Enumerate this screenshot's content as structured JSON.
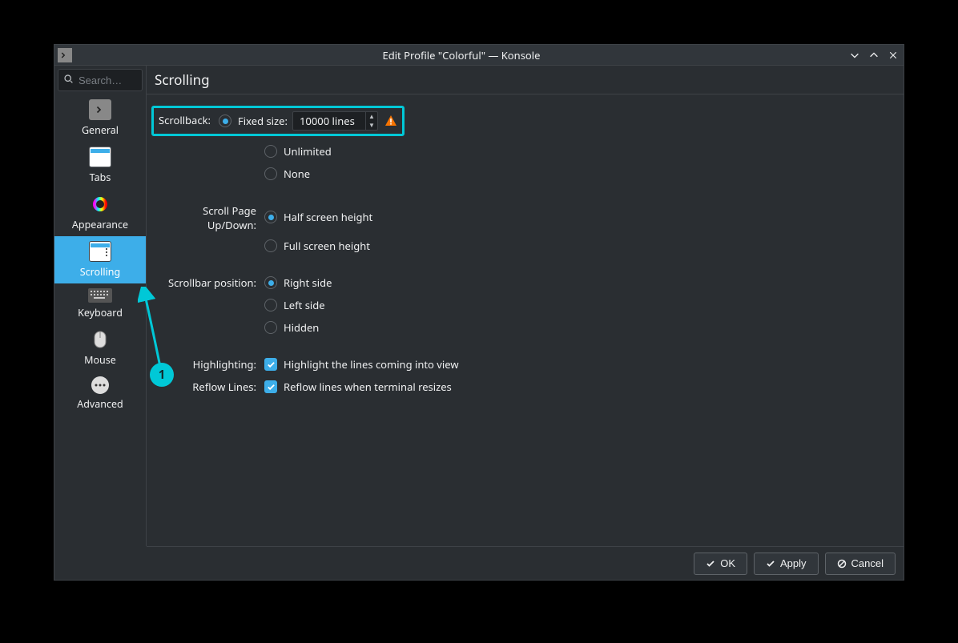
{
  "window": {
    "title": "Edit Profile \"Colorful\" — Konsole"
  },
  "sidebar": {
    "search_placeholder": "Search…",
    "items": [
      {
        "label": "General"
      },
      {
        "label": "Tabs"
      },
      {
        "label": "Appearance"
      },
      {
        "label": "Scrolling"
      },
      {
        "label": "Keyboard"
      },
      {
        "label": "Mouse"
      },
      {
        "label": "Advanced"
      }
    ],
    "selected_index": 3
  },
  "page": {
    "title": "Scrolling",
    "scrollback": {
      "label": "Scrollback:",
      "options": {
        "fixed": "Fixed size:",
        "unlimited": "Unlimited",
        "none": "None"
      },
      "selected": "fixed",
      "fixed_value": "10000 lines"
    },
    "scroll_page": {
      "label": "Scroll Page Up/Down:",
      "options": {
        "half": "Half screen height",
        "full": "Full screen height"
      },
      "selected": "half"
    },
    "scrollbar_pos": {
      "label": "Scrollbar position:",
      "options": {
        "right": "Right side",
        "left": "Left side",
        "hidden": "Hidden"
      },
      "selected": "right"
    },
    "highlighting": {
      "label": "Highlighting:",
      "option": "Highlight the lines coming into view",
      "checked": true
    },
    "reflow": {
      "label": "Reflow Lines:",
      "option": "Reflow lines when terminal resizes",
      "checked": true
    }
  },
  "footer": {
    "ok": "OK",
    "apply": "Apply",
    "cancel": "Cancel"
  },
  "annotation": {
    "badge": "1"
  }
}
